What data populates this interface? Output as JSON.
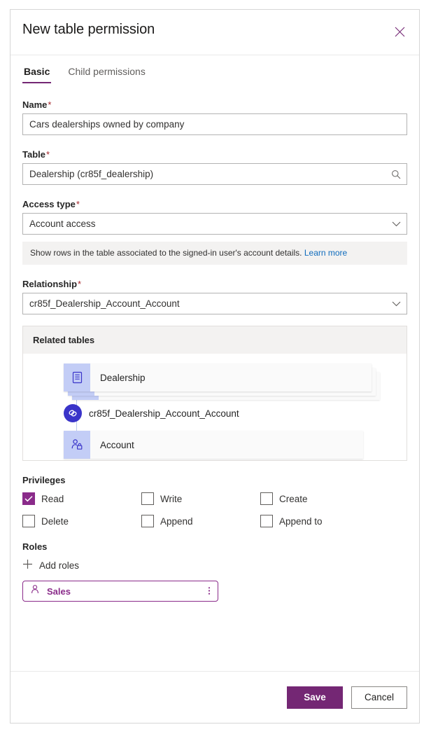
{
  "dialog": {
    "title": "New table permission",
    "close_icon": "close-icon"
  },
  "tabs": [
    {
      "label": "Basic",
      "active": true
    },
    {
      "label": "Child permissions",
      "active": false
    }
  ],
  "form": {
    "name": {
      "label": "Name",
      "required": "*",
      "value": "Cars dealerships owned by company"
    },
    "table": {
      "label": "Table",
      "required": "*",
      "value": "Dealership (cr85f_dealership)",
      "icon": "search-icon"
    },
    "access_type": {
      "label": "Access type",
      "required": "*",
      "value": "Account access",
      "icon": "chevron-down-icon",
      "info_text": "Show rows in the table associated to the signed-in user's account details.",
      "info_link": "Learn more"
    },
    "relationship": {
      "label": "Relationship",
      "required": "*",
      "value": "cr85f_Dealership_Account_Account",
      "icon": "chevron-down-icon"
    }
  },
  "related_tables": {
    "header": "Related tables",
    "source_node": {
      "label": "Dealership",
      "icon": "table-icon"
    },
    "relationship_node": {
      "label": "cr85f_Dealership_Account_Account",
      "icon": "link-icon"
    },
    "target_node": {
      "label": "Account",
      "icon": "account-icon"
    }
  },
  "privileges": {
    "header": "Privileges",
    "items": [
      {
        "label": "Read",
        "checked": true
      },
      {
        "label": "Write",
        "checked": false
      },
      {
        "label": "Create",
        "checked": false
      },
      {
        "label": "Delete",
        "checked": false
      },
      {
        "label": "Append",
        "checked": false
      },
      {
        "label": "Append to",
        "checked": false
      }
    ]
  },
  "roles": {
    "header": "Roles",
    "add_label": "Add roles",
    "add_icon": "plus-icon",
    "items": [
      {
        "name": "Sales",
        "icon": "person-icon",
        "menu_icon": "more-vertical-icon"
      }
    ]
  },
  "footer": {
    "save_label": "Save",
    "cancel_label": "Cancel"
  },
  "colors": {
    "accent": "#742774",
    "accent_light": "#8a2b8a",
    "required": "#a4262c",
    "link": "#0f6cbd",
    "node_icon_bg": "#c3cdf6",
    "relationship_circle": "#3a34c9"
  }
}
